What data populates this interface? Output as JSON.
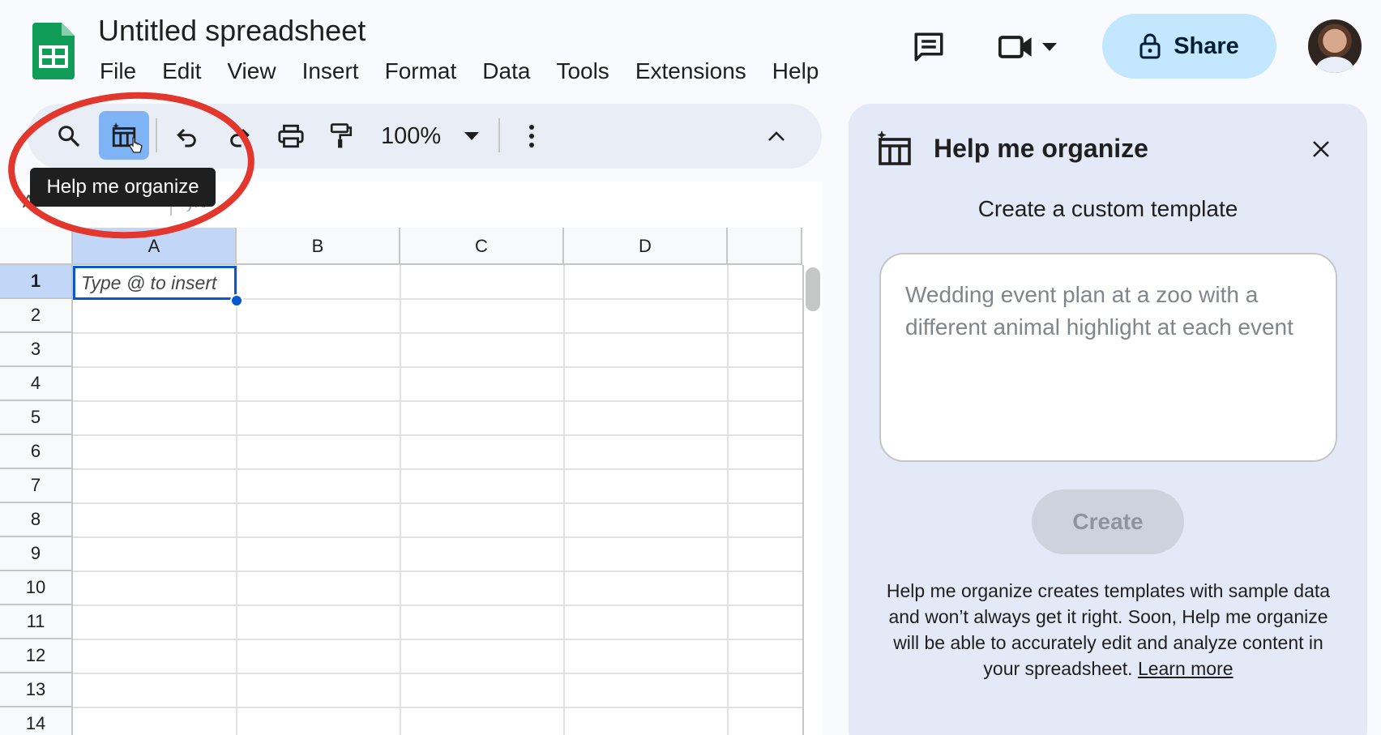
{
  "app": {
    "doc_title": "Untitled spreadsheet",
    "menu": [
      "File",
      "Edit",
      "View",
      "Insert",
      "Format",
      "Data",
      "Tools",
      "Extensions",
      "Help"
    ],
    "share_label": "Share",
    "brand_color": "#0f9d58",
    "share_bg": "#c2e7ff"
  },
  "toolbar": {
    "zoom": "100%",
    "tooltip": "Help me organize",
    "icons": [
      "search-icon",
      "organize-icon",
      "undo-icon",
      "redo-icon",
      "print-icon",
      "paint-format-icon",
      "zoom-dropdown-icon",
      "more-vert-icon",
      "collapse-icon"
    ],
    "highlight_color": "#e3362c"
  },
  "formula_bar": {
    "fx": "fx"
  },
  "grid": {
    "columns": [
      "A",
      "B",
      "C",
      "D"
    ],
    "rows": [
      "1",
      "2",
      "3",
      "4",
      "5",
      "6",
      "7",
      "8",
      "9",
      "10",
      "11",
      "12",
      "13",
      "14"
    ],
    "active_cell_placeholder": "Type @ to insert",
    "selection_color": "#0b57d0"
  },
  "side_panel": {
    "title": "Help me organize",
    "subtitle": "Create a custom template",
    "prompt_placeholder": "Wedding event plan at a zoo with a different animal highlight at each event",
    "create_label": "Create",
    "disclaimer": "Help me organize creates templates with sample data and won’t always get it right. Soon, Help me organize will be able to accurately edit and analyze content in your spreadsheet.",
    "learn_more": "Learn more"
  }
}
